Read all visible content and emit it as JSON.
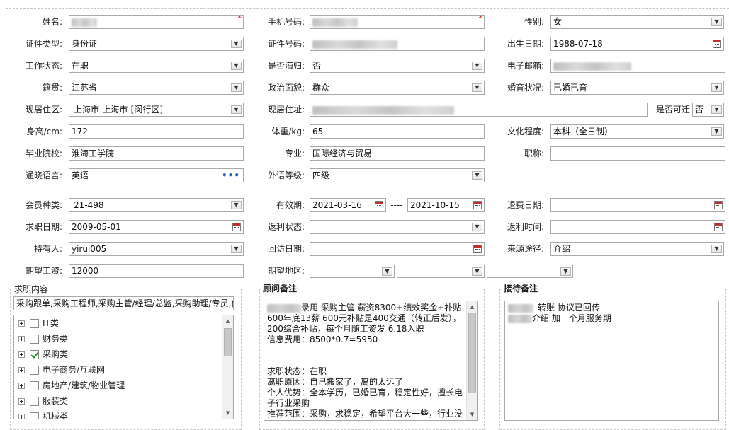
{
  "basic": {
    "name": {
      "label": "姓名:"
    },
    "phone": {
      "label": "手机号码:"
    },
    "gender": {
      "label": "性别:",
      "value": "女"
    },
    "id_type": {
      "label": "证件类型:",
      "value": "身份证"
    },
    "id_number": {
      "label": "证件号码:"
    },
    "birth_date": {
      "label": "出生日期:",
      "value": "1988-07-18"
    },
    "work_status": {
      "label": "工作状态:",
      "value": "在职"
    },
    "returnee": {
      "label": "是否海归:",
      "value": "否"
    },
    "email": {
      "label": "电子邮箱:"
    },
    "native_place": {
      "label": "籍贯:",
      "value": "江苏省"
    },
    "political": {
      "label": "政治面貌:",
      "value": "群众"
    },
    "marital": {
      "label": "婚育状况:",
      "value": "已婚已育"
    },
    "residence_area": {
      "label": "现居住区:",
      "value": "上海市-上海市-[闵行区]"
    },
    "address": {
      "label": "现居住址:"
    },
    "accept_remote": {
      "label": "是否可迁",
      "value": "否"
    },
    "height": {
      "label": "身高/cm:",
      "value": "172"
    },
    "weight": {
      "label": "体重/kg:",
      "value": "65"
    },
    "education": {
      "label": "文化程度:",
      "value": "本科（全日制）"
    },
    "school": {
      "label": "毕业院校:",
      "value": "淮海工学院"
    },
    "major": {
      "label": "专业:",
      "value": "国际经济与贸易"
    },
    "title": {
      "label": "职称:",
      "value": ""
    },
    "language": {
      "label": "通晓语言:",
      "value": "英语"
    },
    "language_level": {
      "label": "外语等级:",
      "value": "四级"
    },
    "required_mark": "*",
    "more_glyph": "•••"
  },
  "member": {
    "type": {
      "label": "会员种类:",
      "value": "21-498"
    },
    "valid_period": {
      "label": "有效期:",
      "from": "2021-03-16",
      "sep": "----",
      "to": "2021-10-15"
    },
    "refund_date": {
      "label": "退费日期:",
      "value": ""
    },
    "job_date": {
      "label": "求职日期:",
      "value": "2009-05-01"
    },
    "rebate_status": {
      "label": "返利状态:",
      "value": ""
    },
    "rebate_time": {
      "label": "返利时间:",
      "value": ""
    },
    "holder": {
      "label": "持有人:",
      "value": "yirui005"
    },
    "visit_date": {
      "label": "回访日期:",
      "value": ""
    },
    "source": {
      "label": "来源途径:",
      "value": "介绍"
    },
    "expected_salary": {
      "label": "期望工资:",
      "value": "12000"
    },
    "expected_region": {
      "label": "期望地区:"
    }
  },
  "job_content": {
    "title": "求职内容",
    "summary": "采购跟单,采购工程师,采购主管/经理/总监,采购助理/专员,供",
    "tree": [
      {
        "label": "IT类",
        "checked": false
      },
      {
        "label": "财务类",
        "checked": false
      },
      {
        "label": "采购类",
        "checked": true
      },
      {
        "label": "电子商务/互联网",
        "checked": false
      },
      {
        "label": "房地产/建筑/物业管理",
        "checked": false
      },
      {
        "label": "服装类",
        "checked": false
      },
      {
        "label": "机械类",
        "checked": false
      }
    ]
  },
  "advisor_notes": {
    "title": "顾问备注",
    "line1": "录用   采购主管   薪资8300+绩效奖金+补贴",
    "line2": "600年底13薪   600元补贴是400交通（转正后发），",
    "line3": "200综合补贴，每个月随工资发      6.18入职",
    "line4": "信息费用：8500*0.7=5950",
    "line5": "求职状态：在职",
    "line6": "离职原因：自己搬家了，离的太远了",
    "line7": "个人优势：全本学历，已婚已育，稳定性好，擅长电",
    "line8": "子行业采购",
    "line9": "推荐范围：采购，求稳定，希望平台大一些，行业没"
  },
  "reception_notes": {
    "title": "接待备注",
    "line1": "转账  协议已回传",
    "line2": "介绍  加一个月服务期"
  },
  "icons": {
    "dropdown": "▼",
    "scroll_up": "▲",
    "scroll_down": "▼"
  }
}
